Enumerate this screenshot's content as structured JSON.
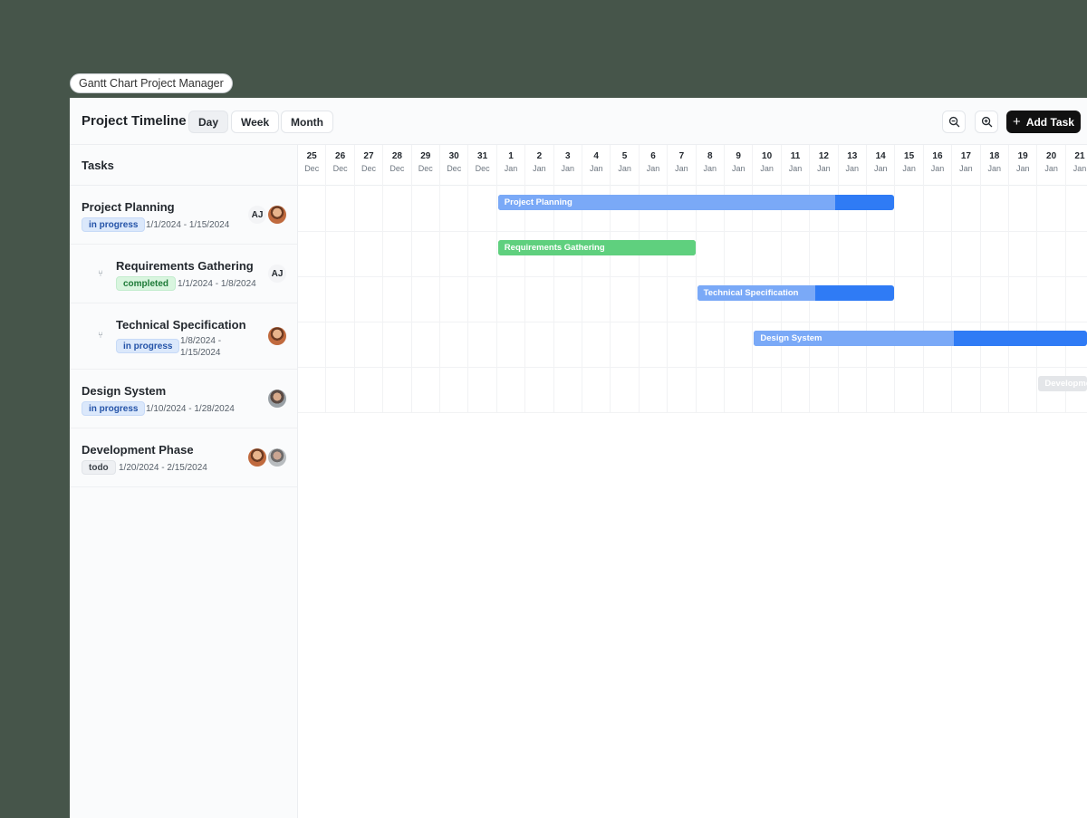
{
  "app_tag": "Gantt Chart Project Manager",
  "toolbar": {
    "title": "Project Timeline",
    "views": [
      "Day",
      "Week",
      "Month"
    ],
    "active_view": "Day",
    "add_task_label": "Add Task"
  },
  "task_panel": {
    "header": "Tasks",
    "tasks": [
      {
        "name": "Project Planning",
        "status": "in progress",
        "dates": "1/1/2024 - 1/15/2024",
        "subtask": false,
        "assignees": [
          "AJ",
          "photo"
        ]
      },
      {
        "name": "Requirements Gathering",
        "status": "completed",
        "dates": "1/1/2024 - 1/8/2024",
        "subtask": true,
        "assignees": [
          "AJ"
        ]
      },
      {
        "name": "Technical Specification",
        "status": "in progress",
        "dates": "1/8/2024 - 1/15/2024",
        "subtask": true,
        "assignees": [
          "photo"
        ]
      },
      {
        "name": "Design System",
        "status": "in progress",
        "dates": "1/10/2024 - 1/28/2024",
        "subtask": false,
        "assignees": [
          "photo"
        ]
      },
      {
        "name": "Development Phase",
        "status": "todo",
        "dates": "1/20/2024 - 2/15/2024",
        "subtask": false,
        "assignees": [
          "photo",
          "photo"
        ]
      }
    ]
  },
  "timeline": {
    "days": [
      {
        "d": "25",
        "m": "Dec"
      },
      {
        "d": "26",
        "m": "Dec"
      },
      {
        "d": "27",
        "m": "Dec"
      },
      {
        "d": "28",
        "m": "Dec"
      },
      {
        "d": "29",
        "m": "Dec"
      },
      {
        "d": "30",
        "m": "Dec"
      },
      {
        "d": "31",
        "m": "Dec"
      },
      {
        "d": "1",
        "m": "Jan"
      },
      {
        "d": "2",
        "m": "Jan"
      },
      {
        "d": "3",
        "m": "Jan"
      },
      {
        "d": "4",
        "m": "Jan"
      },
      {
        "d": "5",
        "m": "Jan"
      },
      {
        "d": "6",
        "m": "Jan"
      },
      {
        "d": "7",
        "m": "Jan"
      },
      {
        "d": "8",
        "m": "Jan"
      },
      {
        "d": "9",
        "m": "Jan"
      },
      {
        "d": "10",
        "m": "Jan"
      },
      {
        "d": "11",
        "m": "Jan"
      },
      {
        "d": "12",
        "m": "Jan"
      },
      {
        "d": "13",
        "m": "Jan"
      },
      {
        "d": "14",
        "m": "Jan"
      },
      {
        "d": "15",
        "m": "Jan"
      },
      {
        "d": "16",
        "m": "Jan"
      },
      {
        "d": "17",
        "m": "Jan"
      },
      {
        "d": "18",
        "m": "Jan"
      },
      {
        "d": "19",
        "m": "Jan"
      },
      {
        "d": "20",
        "m": "Jan"
      },
      {
        "d": "21",
        "m": "Jan"
      }
    ],
    "bars": [
      {
        "label": "Project Planning",
        "start": "1 Jan",
        "end": "14 Jan",
        "progress": 0.85,
        "base": "#2f7bf5",
        "light": "#7aa9f7"
      },
      {
        "label": "Requirements Gathering",
        "start": "1 Jan",
        "end": "7 Jan",
        "progress": 1.0,
        "base": "#5fd07e",
        "light": "#5fd07e"
      },
      {
        "label": "Technical Specification",
        "start": "8 Jan",
        "end": "14 Jan",
        "progress": 0.6,
        "base": "#2f7bf5",
        "light": "#7aa9f7"
      },
      {
        "label": "Design System",
        "start": "10 Jan",
        "end": "21 Jan",
        "progress": 0.6,
        "base": "#2f7bf5",
        "light": "#7aa9f7"
      },
      {
        "label": "Development Phase",
        "start": "20 Jan",
        "end": "21 Jan",
        "progress": 0.0,
        "base": "#e4e6e9",
        "light": "#e4e6e9"
      }
    ]
  },
  "colors": {
    "background": "#46554a",
    "accent_blue": "#2f7bf5",
    "accent_green": "#5fd07e",
    "primary_button": "#111111"
  }
}
